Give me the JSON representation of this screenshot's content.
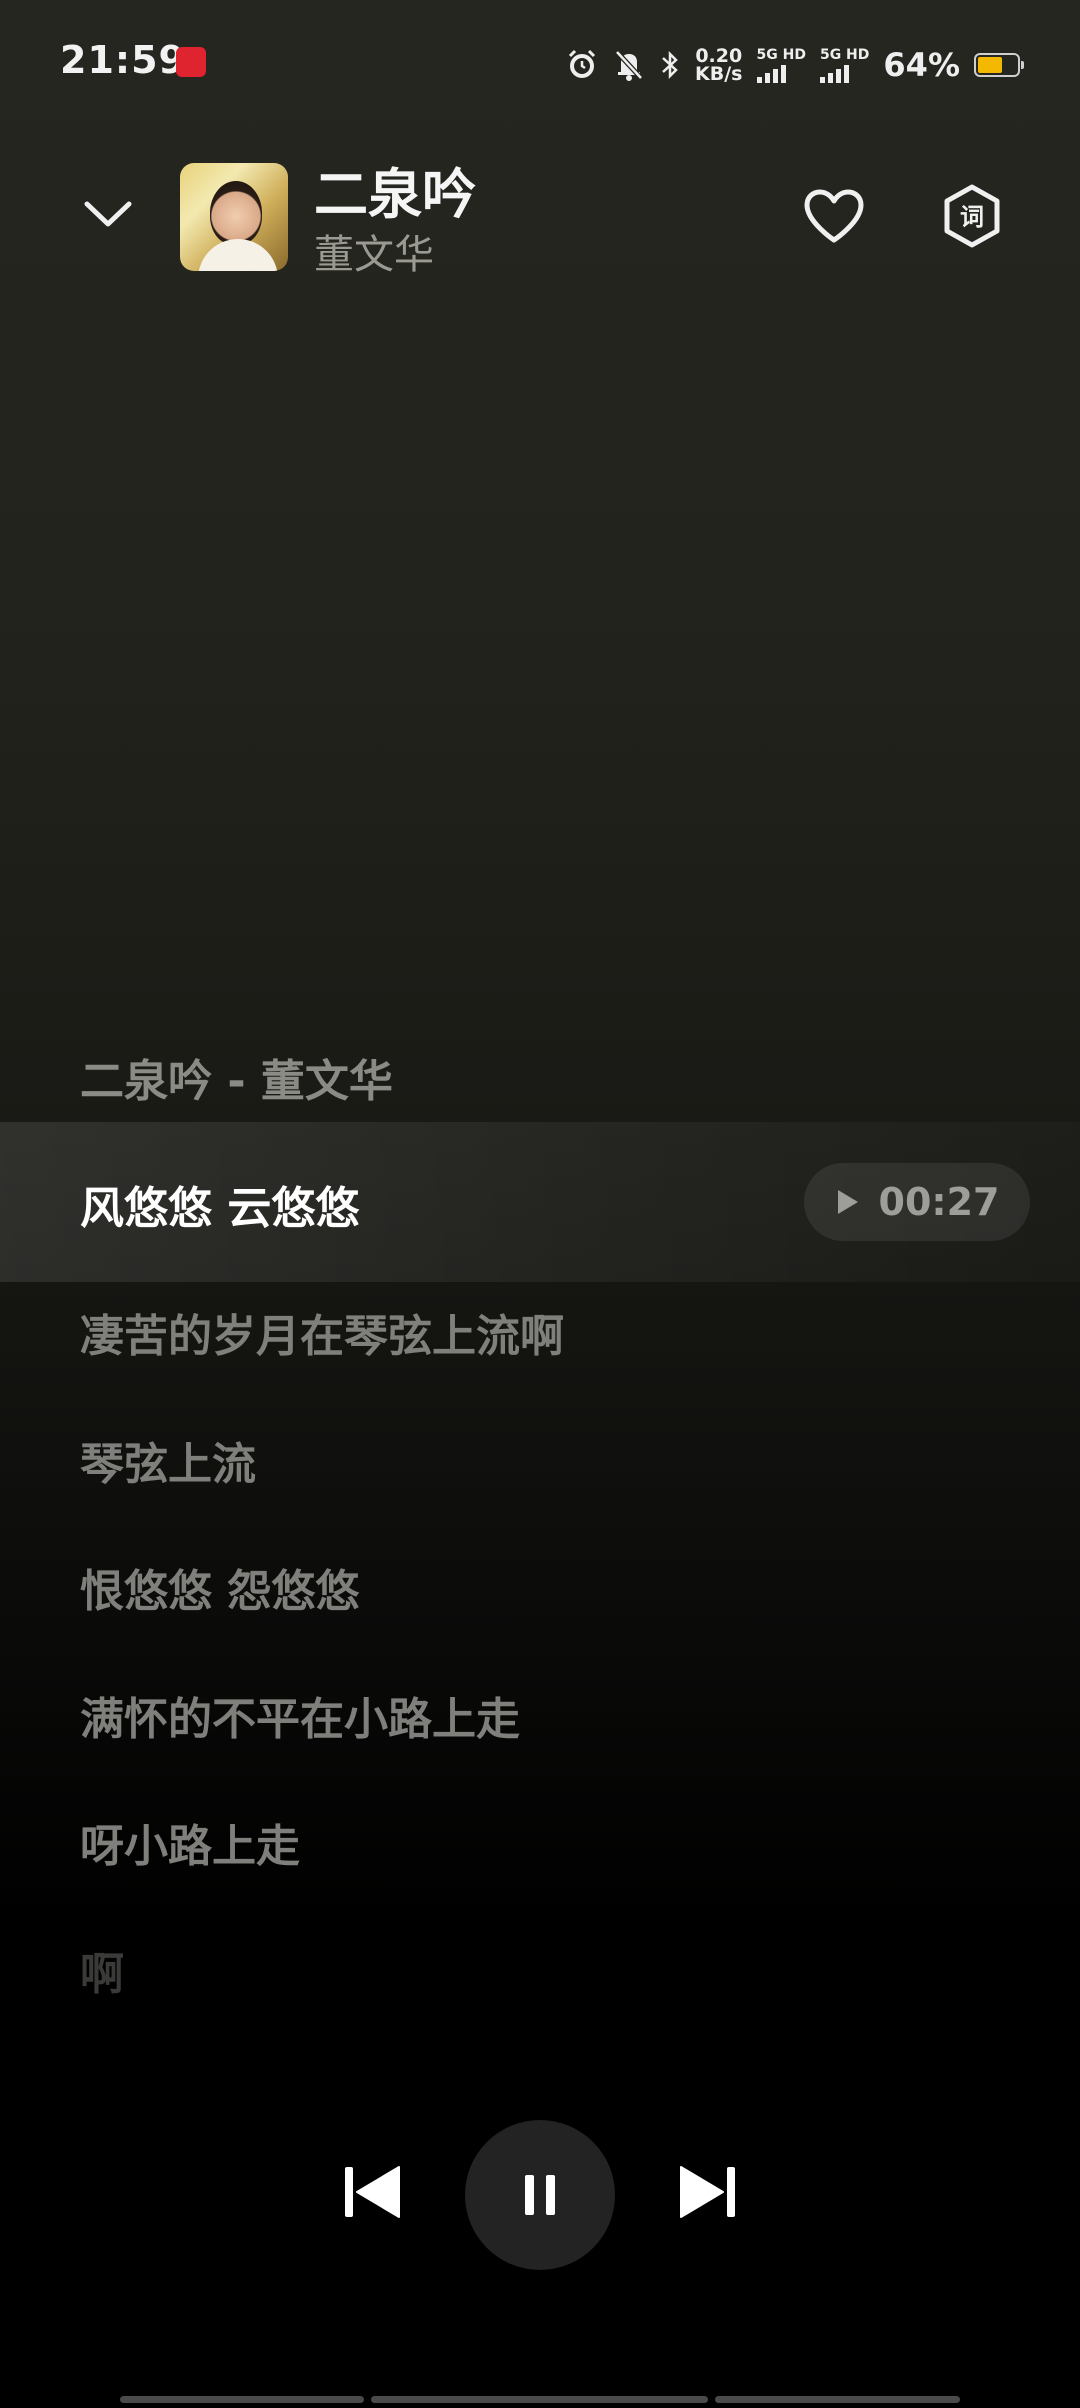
{
  "status_bar": {
    "time": "21:59",
    "net_speed_value": "0.20",
    "net_speed_unit": "KB/s",
    "sim1_label": "5G HD",
    "sim2_label": "5G HD",
    "battery_percent": "64%",
    "battery_level": 0.64,
    "battery_color": "#f5b800"
  },
  "header": {
    "title": "二泉吟",
    "artist": "董文华",
    "lyrics_button_label": "词"
  },
  "lyrics": {
    "header_line": "二泉吟 - 董文华",
    "active_line": "风悠悠 云悠悠",
    "seek_time": "00:27",
    "lines": [
      "凄苦的岁月在琴弦上流啊",
      "琴弦上流",
      "恨悠悠 怨悠悠",
      "满怀的不平在小路上走",
      "呀小路上走",
      "啊"
    ]
  },
  "colors": {
    "accent": "#f5b800",
    "background_top": "#262620",
    "background_bottom": "#000000",
    "inactive_lyric": "#7f7f7c",
    "active_lyric": "#ffffff"
  },
  "icons": {
    "collapse": "chevron-down-icon",
    "like": "heart-outline-icon",
    "lyrics": "lyrics-hexagon-icon",
    "prev": "skip-previous-icon",
    "pause": "pause-icon",
    "next": "skip-next-icon",
    "seek_play": "play-icon"
  }
}
